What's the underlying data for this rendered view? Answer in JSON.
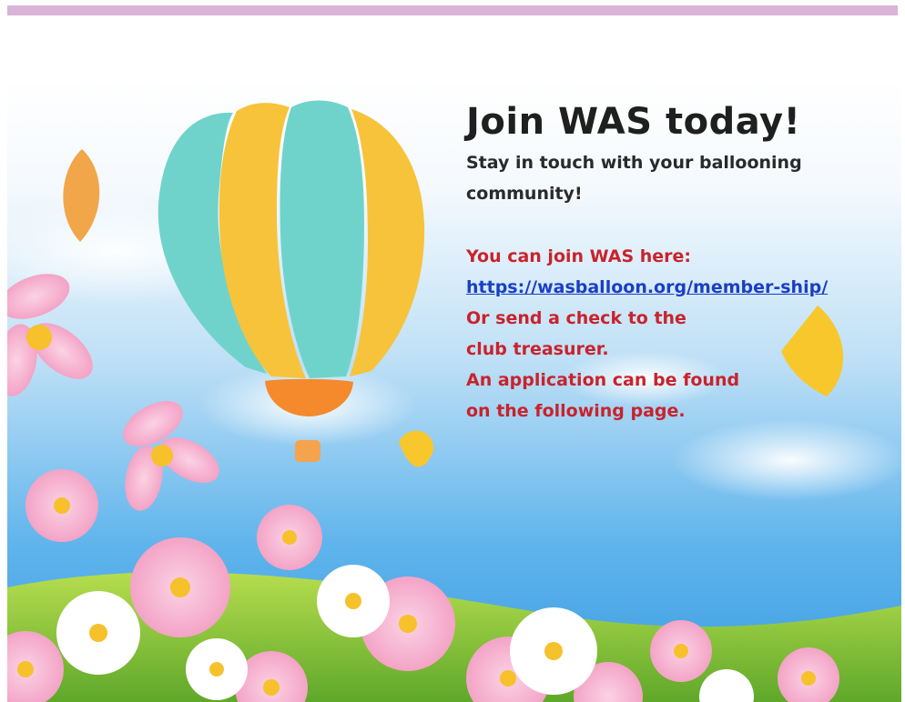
{
  "headline": "Join WAS today!",
  "subline": "Stay in touch with your ballooning community!",
  "join_intro": "You can join WAS here:",
  "membership_link": "https://wasballoon.org/member-ship/",
  "alt_line_1": "Or send a check to the",
  "alt_line_2": "club treasurer.",
  "app_line_1": "An application can be found",
  "app_line_2": "on the following page.",
  "colors": {
    "banner": "#d9b3d8",
    "headline": "#1f1f1f",
    "accent_text": "#c8232c",
    "link": "#1a3fc4",
    "sky": "#4aa6e6",
    "grass": "#8cc63f"
  },
  "illustration": "hot-air-balloon-flowers-illustration"
}
